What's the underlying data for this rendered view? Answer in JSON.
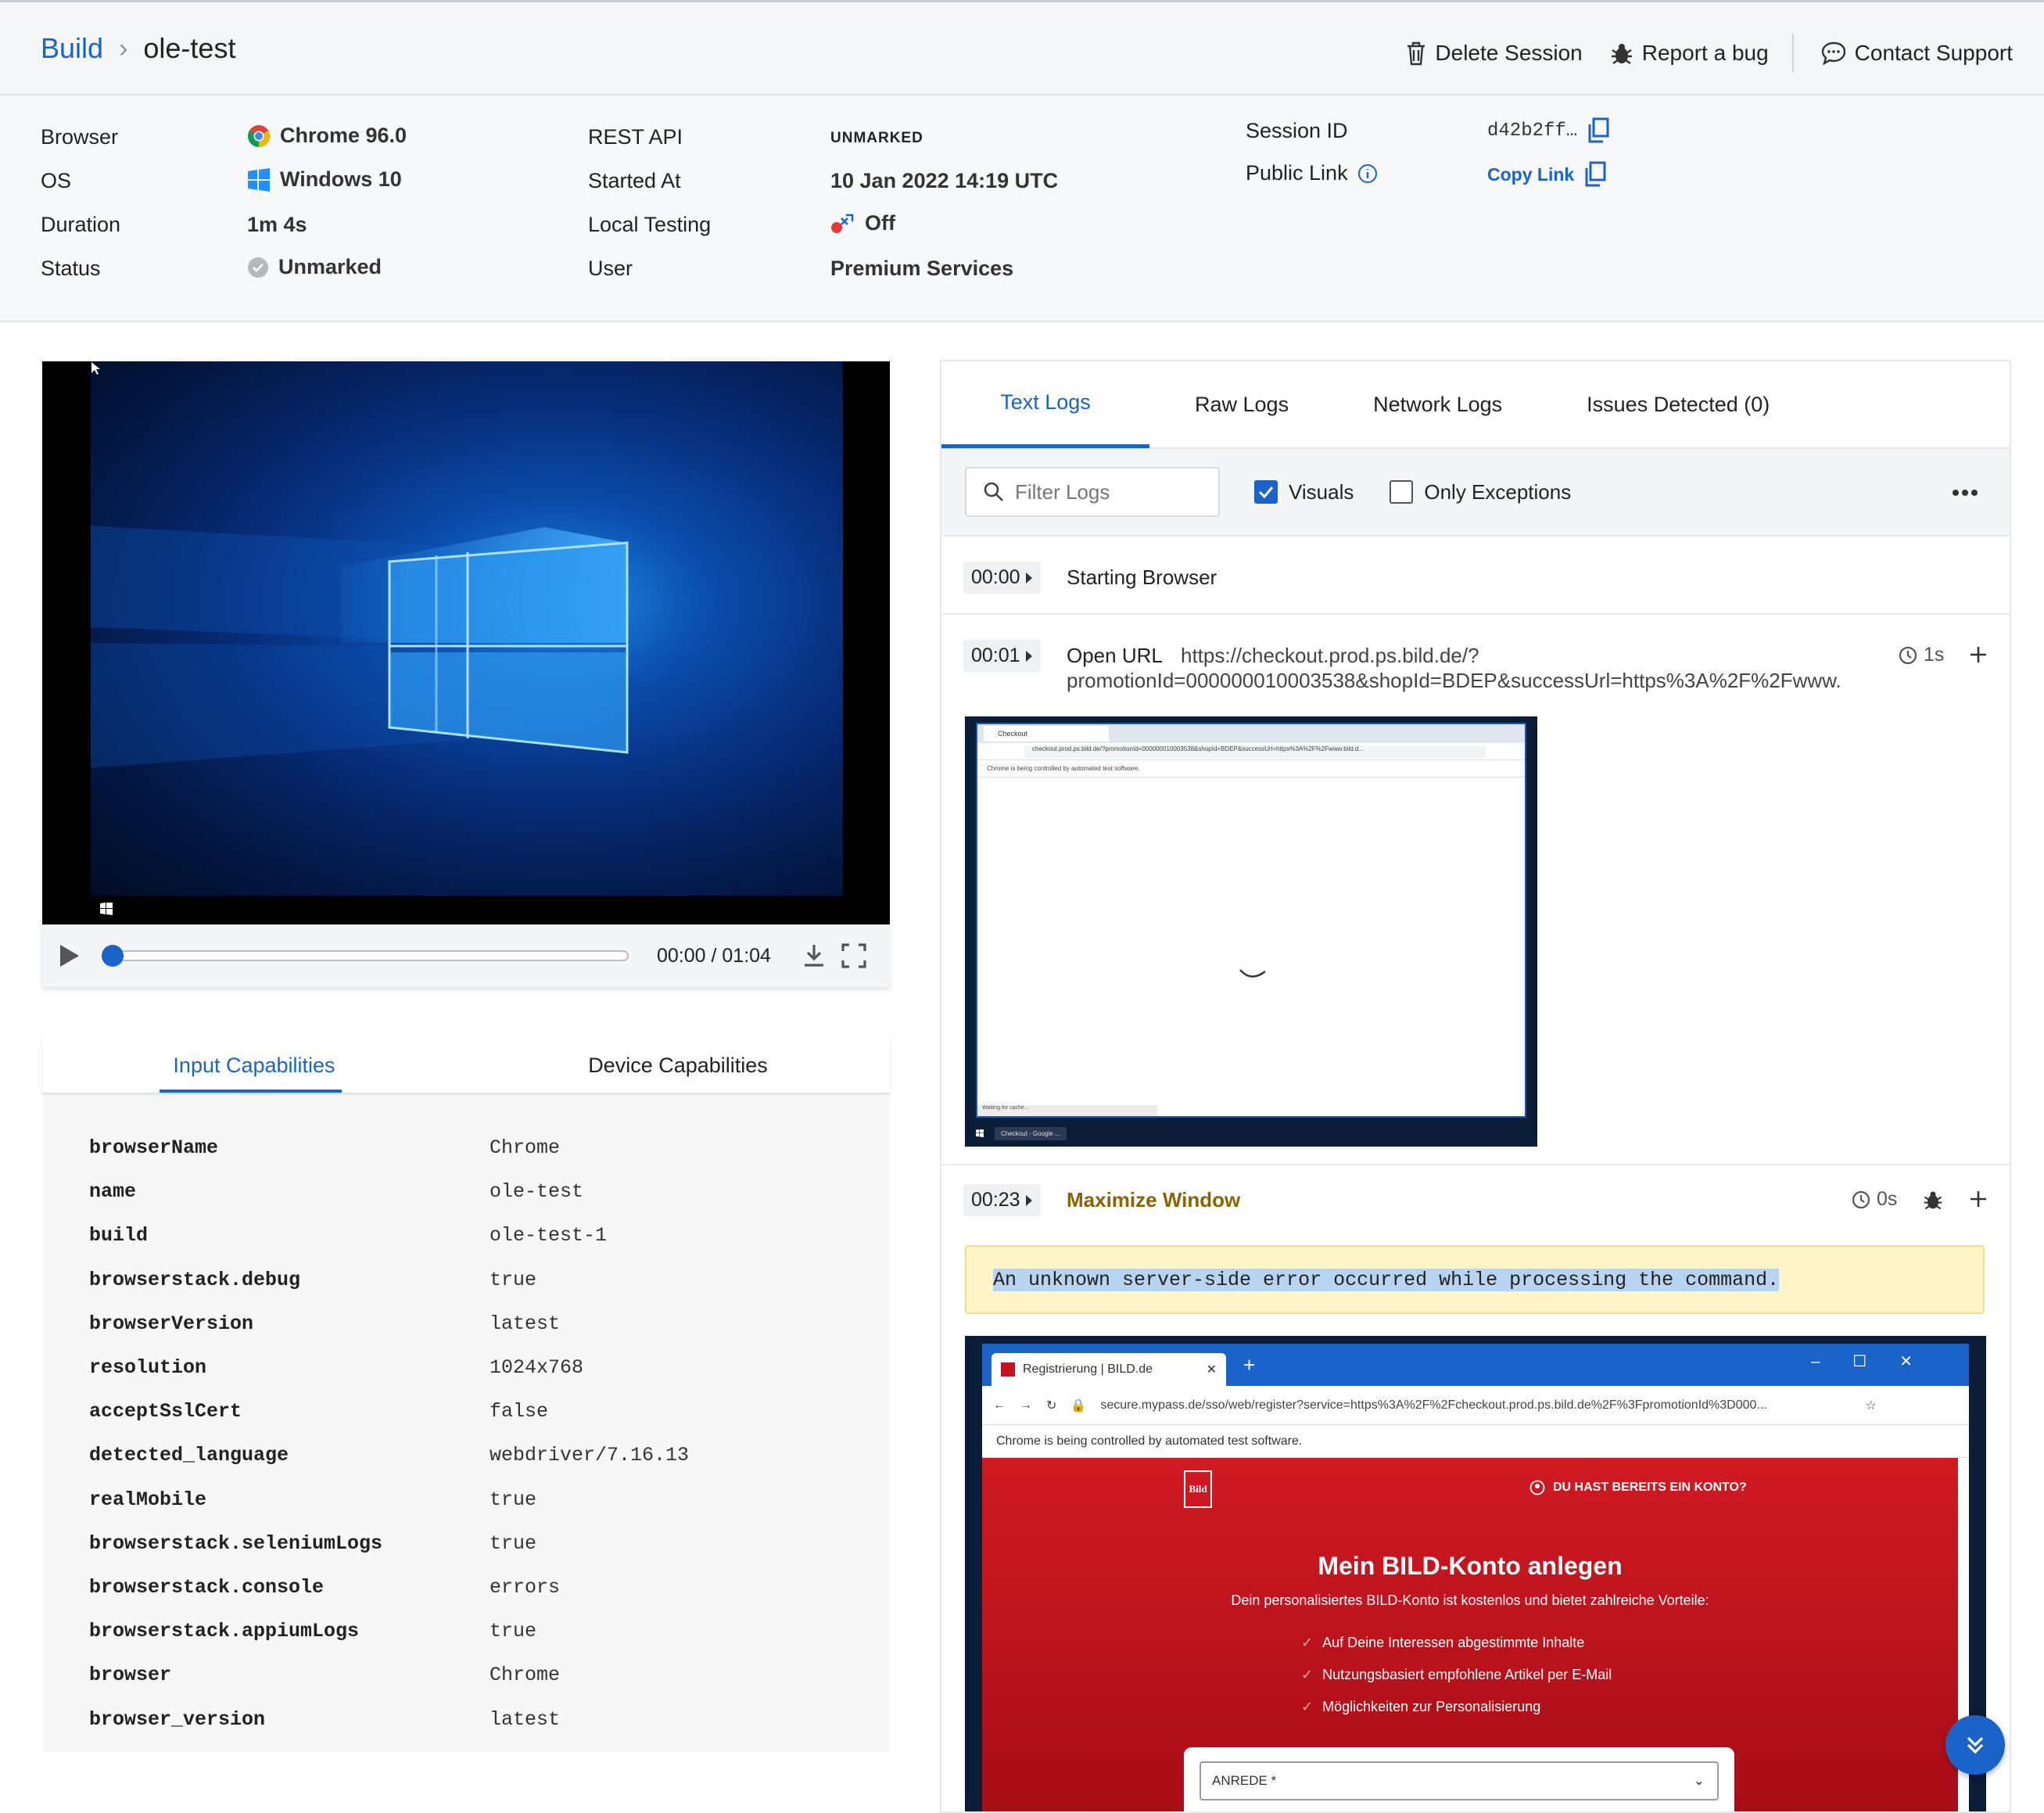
{
  "breadcrumb": {
    "build": "Build",
    "separator": ">",
    "current": "ole-test"
  },
  "header_actions": {
    "delete": "Delete Session",
    "report": "Report a bug",
    "support": "Contact Support"
  },
  "session_info": {
    "browser_label": "Browser",
    "browser_value": "Chrome 96.0",
    "os_label": "OS",
    "os_value": "Windows 10",
    "duration_label": "Duration",
    "duration_value": "1m 4s",
    "status_label": "Status",
    "status_value": "Unmarked",
    "rest_label": "REST API",
    "rest_value": "UNMARKED",
    "started_label": "Started At",
    "started_value": "10 Jan 2022 14:19 UTC",
    "local_label": "Local Testing",
    "local_value": "Off",
    "user_label": "User",
    "user_value": "Premium Services",
    "session_id_label": "Session ID",
    "session_id_value": "d42b2ff…",
    "public_link_label": "Public Link",
    "copy_link": "Copy Link"
  },
  "video": {
    "time": "00:00 / 01:04",
    "progress": 0.0
  },
  "capabilities": {
    "tabs": [
      "Input Capabilities",
      "Device Capabilities"
    ],
    "rows": [
      {
        "key": "browserName",
        "value": "Chrome"
      },
      {
        "key": "name",
        "value": "ole-test"
      },
      {
        "key": "build",
        "value": "ole-test-1"
      },
      {
        "key": "browserstack.debug",
        "value": "true"
      },
      {
        "key": "browserVersion",
        "value": "latest"
      },
      {
        "key": "resolution",
        "value": "1024x768"
      },
      {
        "key": "acceptSslCert",
        "value": "false"
      },
      {
        "key": "detected_language",
        "value": "webdriver/7.16.13"
      },
      {
        "key": "realMobile",
        "value": "true"
      },
      {
        "key": "browserstack.seleniumLogs",
        "value": "true"
      },
      {
        "key": "browserstack.console",
        "value": "errors"
      },
      {
        "key": "browserstack.appiumLogs",
        "value": "true"
      },
      {
        "key": "browser",
        "value": "Chrome"
      },
      {
        "key": "browser_version",
        "value": "latest"
      }
    ]
  },
  "logs": {
    "tabs": [
      "Text Logs",
      "Raw Logs",
      "Network Logs",
      "Issues Detected (0)"
    ],
    "filter_placeholder": "Filter Logs",
    "visuals": "Visuals",
    "only_exceptions": "Only Exceptions",
    "entries": [
      {
        "time": "00:00",
        "text": "Starting Browser"
      },
      {
        "time": "00:01",
        "text": "Open URL",
        "url": "https://checkout.prod.ps.bild.de/?",
        "url2": "promotionId=000000010003538&shopId=BDEP&successUrl=https%3A%2F%2Fwww.",
        "duration": "1s"
      },
      {
        "time": "00:23",
        "text": "Maximize Window",
        "duration": "0s"
      }
    ],
    "error": "An unknown server-side error occurred while processing the command."
  },
  "screenshot1": {
    "tab": "Checkout",
    "url": "checkout.prod.ps.bild.de/?promotionId=000000010003538&shopId=BDEP&successUrl=https%3A%2F%2Fwww.bild.d...",
    "banner": "Chrome is being controlled by automated test software.",
    "status": "Waiting for cache...",
    "taskbar": "Checkout - Google ..."
  },
  "screenshot2": {
    "tab": "Registrierung | BILD.de",
    "url": "secure.mypass.de/sso/web/register?service=https%3A%2F%2Fcheckout.prod.ps.bild.de%2F%3FpromotionId%3D000...",
    "banner": "Chrome is being controlled by automated test software.",
    "logo": "Bild",
    "account": "DU HAST BEREITS EIN KONTO?",
    "heading": "Mein BILD-Konto anlegen",
    "sub": "Dein personalisiertes BILD-Konto ist kostenlos und bietet zahlreiche Vorteile:",
    "benefits": [
      "Auf Deine Interessen abgestimmte Inhalte",
      "Nutzungsbasiert empfohlene Artikel per E-Mail",
      "Möglichkeiten zur Personalisierung"
    ],
    "select": "ANREDE *"
  },
  "colors": {
    "accent": "#1a63c9",
    "bild_red": "#c8101e",
    "warning_bg": "#fdf5c8"
  }
}
